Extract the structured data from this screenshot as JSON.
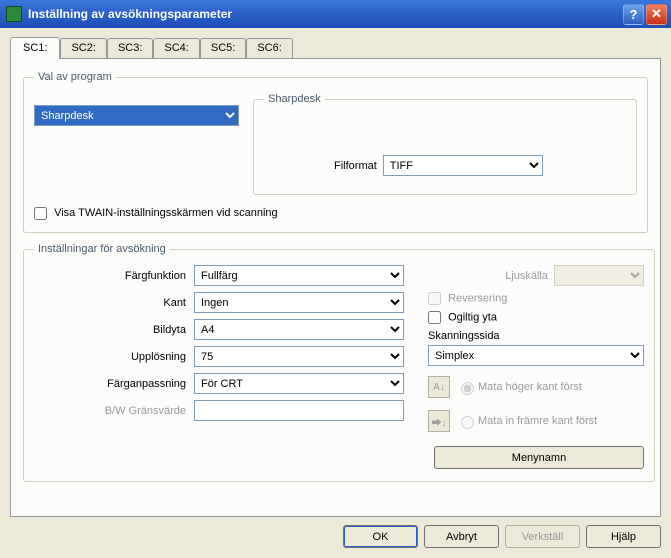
{
  "window": {
    "title": "Inställning av avsökningsparameter"
  },
  "tabs": [
    "SC1:",
    "SC2:",
    "SC3:",
    "SC4:",
    "SC5:",
    "SC6:"
  ],
  "group1": {
    "legend": "Val av program",
    "program_value": "Sharpdesk",
    "sub_legend": "Sharpdesk",
    "fileformat_label": "Filformat",
    "fileformat_value": "TIFF",
    "twain_checkbox": "Visa TWAIN-inställningsskärmen vid scanning"
  },
  "group2": {
    "legend": "Inställningar för avsökning",
    "color_label": "Färgfunktion",
    "color_value": "Fullfärg",
    "edge_label": "Kant",
    "edge_value": "Ingen",
    "area_label": "Bildyta",
    "area_value": "A4",
    "res_label": "Upplösning",
    "res_value": "75",
    "match_label": "Färganpassning",
    "match_value": "För CRT",
    "bw_label": "B/W Gränsvärde",
    "light_label": "Ljuskälla",
    "reverse_label": "Reversering",
    "invalid_label": "Ogiltig yta",
    "scanpage_label": "Skanningssida",
    "scanpage_value": "Simplex",
    "feed_right": "Mata höger kant först",
    "feed_front": "Mata in främre kant först",
    "menuname_btn": "Menynamn"
  },
  "buttons": {
    "ok": "OK",
    "cancel": "Avbryt",
    "apply": "Verkställ",
    "help": "Hjälp"
  }
}
